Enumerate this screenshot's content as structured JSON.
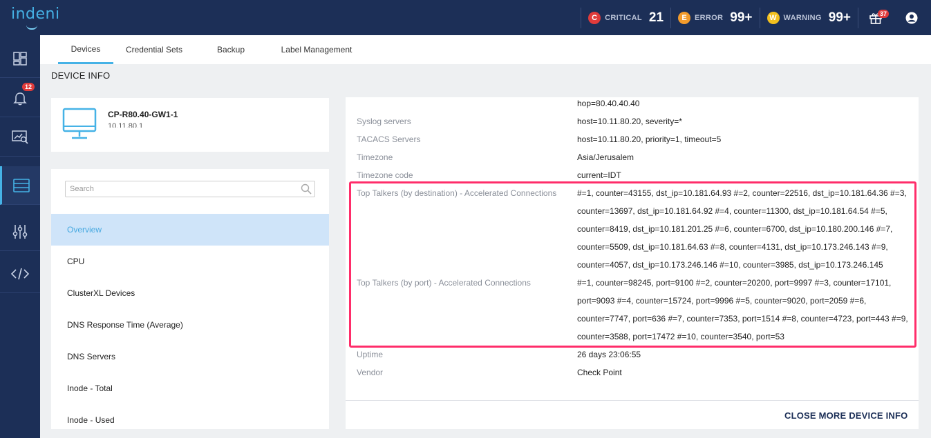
{
  "app": {
    "logo": "indeni"
  },
  "alerts": {
    "critical": {
      "letter": "C",
      "label": "CRITICAL",
      "count": "21",
      "color": "#e03b3b"
    },
    "error": {
      "letter": "E",
      "label": "ERROR",
      "count": "99+",
      "color": "#f29b2c"
    },
    "warning": {
      "letter": "W",
      "label": "WARNING",
      "count": "99+",
      "color": "#f2c01e"
    },
    "gift_badge": "37"
  },
  "sidenav": {
    "notifications_badge": "12"
  },
  "tabs": [
    "Devices",
    "Credential Sets",
    "Backup",
    "Label Management"
  ],
  "page": {
    "section_title": "DEVICE INFO"
  },
  "device": {
    "name": "CP-R80.40-GW1-1",
    "ip": "10.11.80.1"
  },
  "search": {
    "placeholder": "Search",
    "value": ""
  },
  "metrics": [
    "Overview",
    "CPU",
    "ClusterXL Devices",
    "DNS Response Time (Average)",
    "DNS Servers",
    "Inode - Total",
    "Inode - Used"
  ],
  "info": {
    "rows": [
      {
        "key": "",
        "value": "hop=80.40.40.40"
      },
      {
        "key": "Syslog servers",
        "value": "host=10.11.80.20, severity=*"
      },
      {
        "key": "TACACS Servers",
        "value": "host=10.11.80.20, priority=1, timeout=5"
      },
      {
        "key": "Timezone",
        "value": "Asia/Jerusalem"
      },
      {
        "key": "Timezone code",
        "value": "current=IDT"
      },
      {
        "key": "Top Talkers (by destination) - Accelerated Connections",
        "value": "#=1, counter=43155, dst_ip=10.181.64.93 #=2, counter=22516, dst_ip=10.181.64.36 #=3, counter=13697, dst_ip=10.181.64.92 #=4, counter=11300, dst_ip=10.181.64.54 #=5, counter=8419, dst_ip=10.181.201.25 #=6, counter=6700, dst_ip=10.180.200.146 #=7, counter=5509, dst_ip=10.181.64.63 #=8, counter=4131, dst_ip=10.173.246.143 #=9, counter=4057, dst_ip=10.173.246.146 #=10, counter=3985, dst_ip=10.173.246.145"
      },
      {
        "key": "Top Talkers (by port) - Accelerated Connections",
        "value": "#=1, counter=98245, port=9100 #=2, counter=20200, port=9997 #=3, counter=17101, port=9093 #=4, counter=15724, port=9996 #=5, counter=9020, port=2059 #=6, counter=7747, port=636 #=7, counter=7353, port=1514 #=8, counter=4723, port=443 #=9, counter=3588, port=17472 #=10, counter=3540, port=53"
      },
      {
        "key": "Uptime",
        "value": "26 days 23:06:55"
      },
      {
        "key": "Vendor",
        "value": "Check Point"
      }
    ]
  },
  "actions": {
    "close_label": "CLOSE MORE DEVICE INFO"
  },
  "colors": {
    "nav_bg": "#1c2f57",
    "accent": "#45b2e6",
    "highlight": "#ff2d6a",
    "selected_bg": "#cfe4f9"
  }
}
